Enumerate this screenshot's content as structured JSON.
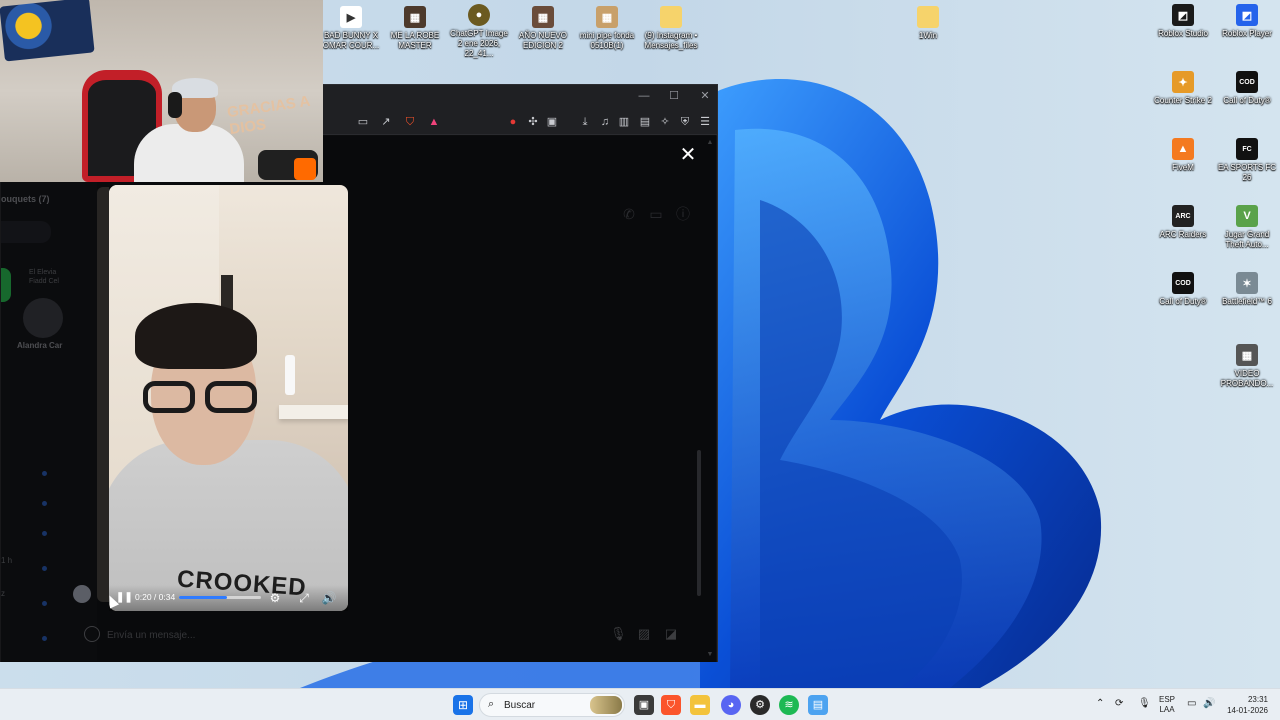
{
  "desktop": {
    "icons": [
      {
        "label": "BAD BUNNY X OMAR COUR...",
        "icon": "video-file-icon"
      },
      {
        "label": "ME LA ROBE MASTER",
        "icon": "video-file-icon"
      },
      {
        "label": "ChatGPT Image 2 ene 2026, 22_41...",
        "icon": "image-file-icon"
      },
      {
        "label": "AÑO NUEVO EDICION 2",
        "icon": "video-file-icon"
      },
      {
        "label": "mini pipe fonda 0510B(1)",
        "icon": "image-file-icon"
      },
      {
        "label": "(9) Instagram • Mensajes_files",
        "icon": "folder-icon"
      },
      {
        "label": "1Win",
        "icon": "folder-icon"
      },
      {
        "label": "Roblox Studio",
        "icon": "roblox-studio-icon"
      },
      {
        "label": "Roblox Player",
        "icon": "roblox-player-icon"
      },
      {
        "label": "Counter Strike 2",
        "icon": "counter-strike-icon"
      },
      {
        "label": "Call of Duty®",
        "icon": "call-of-duty-icon"
      },
      {
        "label": "FiveM",
        "icon": "fivem-icon"
      },
      {
        "label": "EA SPORTS FC 26",
        "icon": "ea-sports-icon"
      },
      {
        "label": "ARC Raiders",
        "icon": "arc-raiders-icon"
      },
      {
        "label": "Jugar Grand Theft Auto...",
        "icon": "gta-icon"
      },
      {
        "label": "Call of Duty®",
        "icon": "call-of-duty-icon"
      },
      {
        "label": "Battlefield™ 6",
        "icon": "battlefield-icon"
      },
      {
        "label": "VIDEO PROBANDO...",
        "icon": "video-file-icon"
      }
    ]
  },
  "chat": {
    "list_header": "ouquets (7)",
    "note_line1": "El Elevia",
    "note_line2": "Fiadd Cel",
    "contact_name": "Alandra Car",
    "trunc_time": "1 h",
    "trunc_char": "z"
  },
  "video": {
    "time": "0:20 / 0:34",
    "progress": 0.59,
    "print_text": "CROOKED",
    "close_symbol": "✕"
  },
  "composer": {
    "placeholder": "Envía un mensaje..."
  },
  "taskbar": {
    "search_placeholder": "Buscar",
    "lang_line1": "ESP",
    "lang_line2": "LAA",
    "time": "23:31",
    "date": "14-01-2026"
  },
  "webcam": {
    "wall_text": "GRACIAS A DIOS"
  },
  "colors": {
    "accent_blue": "#2f7bff",
    "brave_orange": "#fb542b",
    "spotify_green": "#1db954",
    "discord_blurple": "#5865f2"
  }
}
